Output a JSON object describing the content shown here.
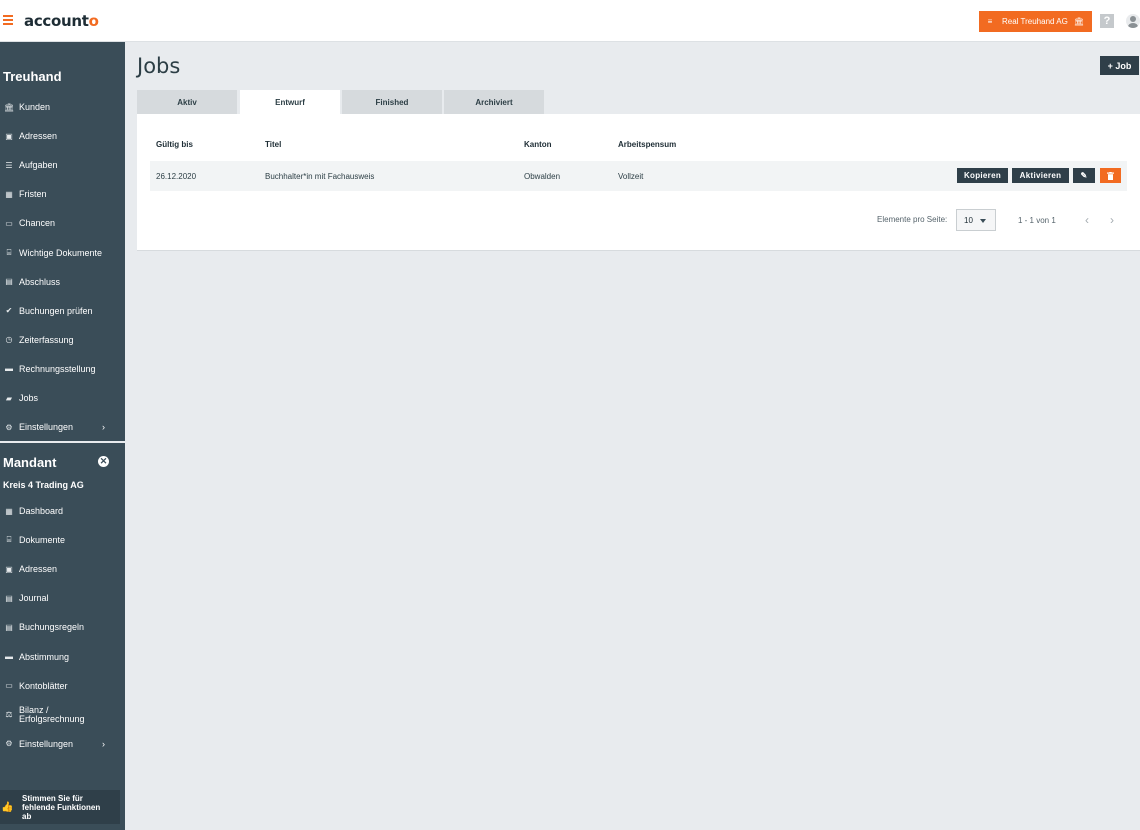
{
  "app": {
    "logo_main": "account",
    "logo_accent": "o"
  },
  "topbar": {
    "company_icon": "list-icon",
    "company_label": "Real Treuhand AG",
    "bank_icon": "bank-icon",
    "help_glyph": "?"
  },
  "sidebar": {
    "treuhand_heading": "Treuhand",
    "treuhand_items": [
      {
        "label": "Kunden",
        "icon": "bank-icon",
        "glyph": "🏛"
      },
      {
        "label": "Adressen",
        "icon": "address-book-icon",
        "glyph": "▣"
      },
      {
        "label": "Aufgaben",
        "icon": "task-list-icon",
        "glyph": "☰"
      },
      {
        "label": "Fristen",
        "icon": "calendar-icon",
        "glyph": "▦"
      },
      {
        "label": "Chancen",
        "icon": "card-icon",
        "glyph": "▭"
      },
      {
        "label": "Wichtige Dokumente",
        "icon": "inbox-icon",
        "glyph": "⌸"
      },
      {
        "label": "Abschluss",
        "icon": "book-icon",
        "glyph": "▤"
      },
      {
        "label": "Buchungen prüfen",
        "icon": "check-icon",
        "glyph": "✔"
      },
      {
        "label": "Zeiterfassung",
        "icon": "clock-icon",
        "glyph": "◷"
      },
      {
        "label": "Rechnungsstellung",
        "icon": "invoice-icon",
        "glyph": "▬"
      },
      {
        "label": "Jobs",
        "icon": "briefcase-icon",
        "glyph": "▰"
      },
      {
        "label": "Einstellungen",
        "icon": "gear-icon",
        "glyph": "⚙",
        "chevron": "›"
      }
    ],
    "mandant_heading": "Mandant",
    "mandant_close_glyph": "✕",
    "mandant_name": "Kreis 4 Trading AG",
    "mandant_items": [
      {
        "label": "Dashboard",
        "icon": "dashboard-icon",
        "glyph": "▦"
      },
      {
        "label": "Dokumente",
        "icon": "documents-icon",
        "glyph": "⌸"
      },
      {
        "label": "Adressen",
        "icon": "address-book-icon",
        "glyph": "▣"
      },
      {
        "label": "Journal",
        "icon": "table-icon",
        "glyph": "▤"
      },
      {
        "label": "Buchungsregeln",
        "icon": "rules-icon",
        "glyph": "▤"
      },
      {
        "label": "Abstimmung",
        "icon": "reconcile-icon",
        "glyph": "▬"
      },
      {
        "label": "Kontoblätter",
        "icon": "ledger-icon",
        "glyph": "▭"
      },
      {
        "label": "Bilanz /\nErfolgsrechnung",
        "icon": "balance-icon",
        "glyph": "⚖"
      },
      {
        "label": "Einstellungen",
        "icon": "gear-icon",
        "glyph": "⚙",
        "chevron": "›"
      }
    ],
    "feedback": {
      "icon": "thumbs-up-icon",
      "glyph": "👍",
      "label": "Stimmen Sie für fehlende Funktionen ab"
    }
  },
  "main": {
    "title": "Jobs",
    "add_button": "+ Job",
    "tabs": [
      {
        "label": "Aktiv",
        "active": false
      },
      {
        "label": "Entwurf",
        "active": true
      },
      {
        "label": "Finished",
        "active": false
      },
      {
        "label": "Archiviert",
        "active": false
      }
    ],
    "table": {
      "headers": [
        "Gültig bis",
        "Titel",
        "Kanton",
        "Arbeitspensum"
      ],
      "rows": [
        {
          "gueltig_bis": "26.12.2020",
          "titel": "Buchhalter*in mit Fachausweis",
          "kanton": "Obwalden",
          "arbeitspensum": "Vollzeit"
        }
      ],
      "row_actions": {
        "copy": "Kopieren",
        "activate": "Aktivieren",
        "edit_icon": "pencil-icon",
        "delete_icon": "trash-icon"
      }
    },
    "pagination": {
      "label": "Elemente pro Seite:",
      "page_size": "10",
      "range": "1 - 1 von 1",
      "prev": "‹",
      "next": "›"
    }
  },
  "colors": {
    "accent": "#f26b21",
    "sidebar": "#3a4d58",
    "dark_button": "#2f3f49",
    "background": "#e8ebee"
  }
}
